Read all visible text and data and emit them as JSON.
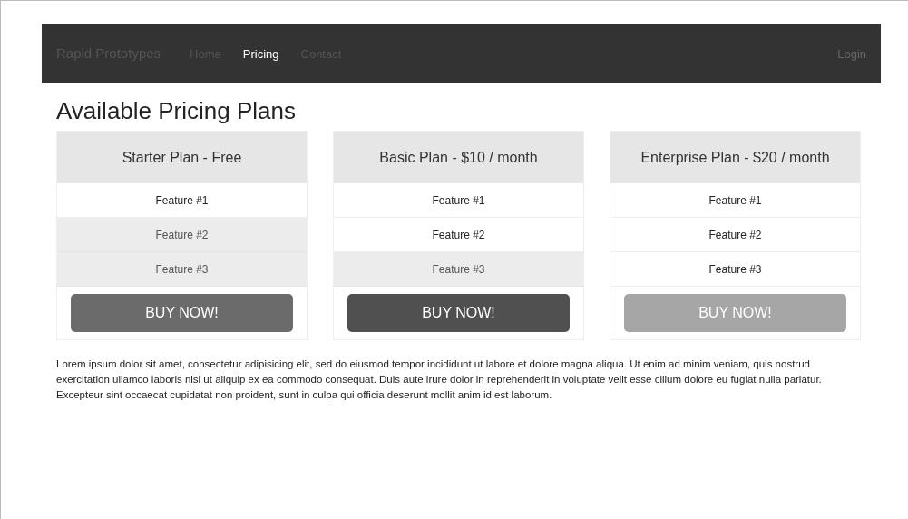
{
  "navbar": {
    "brand": "Rapid Prototypes",
    "links": [
      {
        "label": "Home",
        "selected": false
      },
      {
        "label": "Pricing",
        "selected": true
      },
      {
        "label": "Contact",
        "selected": false
      }
    ],
    "login": "Login"
  },
  "heading": "Available Pricing Plans",
  "plans": [
    {
      "title": "Starter Plan - Free",
      "features": [
        {
          "label": "Feature #1",
          "shaded": false
        },
        {
          "label": "Feature #2",
          "shaded": true
        },
        {
          "label": "Feature #3",
          "shaded": true
        }
      ],
      "button": {
        "label": "BUY NOW!",
        "color": "#6b6b6b"
      }
    },
    {
      "title": "Basic Plan - $10 / month",
      "features": [
        {
          "label": "Feature #1",
          "shaded": false
        },
        {
          "label": "Feature #2",
          "shaded": false
        },
        {
          "label": "Feature #3",
          "shaded": true
        }
      ],
      "button": {
        "label": "BUY NOW!",
        "color": "#505050"
      }
    },
    {
      "title": "Enterprise Plan - $20 / month",
      "features": [
        {
          "label": "Feature #1",
          "shaded": false
        },
        {
          "label": "Feature #2",
          "shaded": false
        },
        {
          "label": "Feature #3",
          "shaded": false
        }
      ],
      "button": {
        "label": "BUY NOW!",
        "color": "#a6a6a6"
      }
    }
  ],
  "paragraph": "Lorem ipsum dolor sit amet, consectetur adipisicing elit, sed do eiusmod tempor incididunt ut labore et dolore magna aliqua. Ut enim ad minim veniam, quis nostrud exercitation ullamco laboris nisi ut aliquip ex ea commodo consequat. Duis aute irure dolor in reprehenderit in voluptate velit esse cillum dolore eu fugiat nulla pariatur. Excepteur sint occaecat cupidatat non proident, sunt in culpa qui officia deserunt mollit anim id est laborum."
}
